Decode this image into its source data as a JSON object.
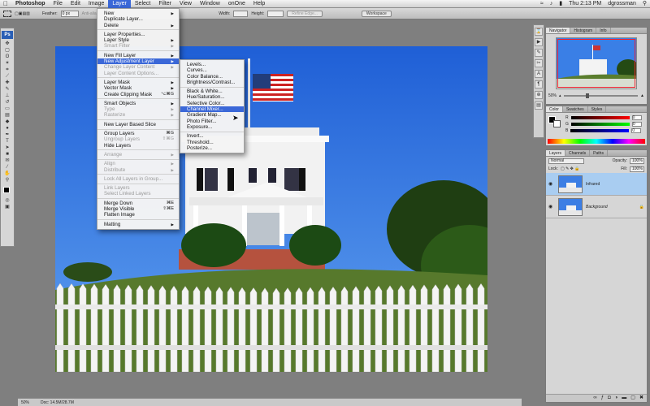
{
  "menubar": {
    "app": "Photoshop",
    "items": [
      "File",
      "Edit",
      "Image",
      "Layer",
      "Select",
      "Filter",
      "View",
      "Window",
      "onOne",
      "Help"
    ],
    "active": "Layer",
    "clock": "Thu 2:13 PM",
    "user": "dgrossman"
  },
  "options": {
    "feather_label": "Feather:",
    "feather_value": "0 px",
    "anti_alias": "Anti-alias",
    "width_label": "Width:",
    "height_label": "Height:",
    "refine_edge": "Refine Edge...",
    "workspace": "Workspace"
  },
  "layer_menu": [
    {
      "label": "New",
      "arrow": true
    },
    {
      "label": "Duplicate Layer..."
    },
    {
      "label": "Delete",
      "arrow": true
    },
    {
      "sep": true
    },
    {
      "label": "Layer Properties..."
    },
    {
      "label": "Layer Style",
      "arrow": true
    },
    {
      "label": "Smart Filter",
      "arrow": true,
      "disabled": true
    },
    {
      "sep": true
    },
    {
      "label": "New Fill Layer",
      "arrow": true
    },
    {
      "label": "New Adjustment Layer",
      "arrow": true,
      "highlight": true
    },
    {
      "label": "Change Layer Content",
      "arrow": true,
      "disabled": true
    },
    {
      "label": "Layer Content Options...",
      "disabled": true
    },
    {
      "sep": true
    },
    {
      "label": "Layer Mask",
      "arrow": true
    },
    {
      "label": "Vector Mask",
      "arrow": true
    },
    {
      "label": "Create Clipping Mask",
      "shortcut": "⌥⌘G"
    },
    {
      "sep": true
    },
    {
      "label": "Smart Objects",
      "arrow": true
    },
    {
      "label": "Type",
      "arrow": true,
      "disabled": true
    },
    {
      "label": "Rasterize",
      "arrow": true,
      "disabled": true
    },
    {
      "sep": true
    },
    {
      "label": "New Layer Based Slice"
    },
    {
      "sep": true
    },
    {
      "label": "Group Layers",
      "shortcut": "⌘G"
    },
    {
      "label": "Ungroup Layers",
      "shortcut": "⇧⌘G",
      "disabled": true
    },
    {
      "label": "Hide Layers"
    },
    {
      "sep": true
    },
    {
      "label": "Arrange",
      "arrow": true,
      "disabled": true
    },
    {
      "sep": true
    },
    {
      "label": "Align",
      "arrow": true,
      "disabled": true
    },
    {
      "label": "Distribute",
      "arrow": true,
      "disabled": true
    },
    {
      "sep": true
    },
    {
      "label": "Lock All Layers in Group...",
      "disabled": true
    },
    {
      "sep": true
    },
    {
      "label": "Link Layers",
      "disabled": true
    },
    {
      "label": "Select Linked Layers",
      "disabled": true
    },
    {
      "sep": true
    },
    {
      "label": "Merge Down",
      "shortcut": "⌘E"
    },
    {
      "label": "Merge Visible",
      "shortcut": "⇧⌘E"
    },
    {
      "label": "Flatten Image"
    },
    {
      "sep": true
    },
    {
      "label": "Matting",
      "arrow": true
    }
  ],
  "adjustment_menu": [
    {
      "label": "Levels..."
    },
    {
      "label": "Curves..."
    },
    {
      "label": "Color Balance..."
    },
    {
      "label": "Brightness/Contrast..."
    },
    {
      "sep": true
    },
    {
      "label": "Black & White..."
    },
    {
      "label": "Hue/Saturation..."
    },
    {
      "label": "Selective Color..."
    },
    {
      "label": "Channel Mixer...",
      "highlight": true
    },
    {
      "label": "Gradient Map..."
    },
    {
      "label": "Photo Filter..."
    },
    {
      "label": "Exposure..."
    },
    {
      "sep": true
    },
    {
      "label": "Invert..."
    },
    {
      "label": "Threshold..."
    },
    {
      "label": "Posterize..."
    }
  ],
  "navigator": {
    "tabs": [
      "Navigator",
      "Histogram",
      "Info"
    ],
    "zoom": "50%"
  },
  "color_panel": {
    "tabs": [
      "Color",
      "Swatches",
      "Styles"
    ],
    "channels": [
      {
        "label": "R",
        "value": "0"
      },
      {
        "label": "G",
        "value": "0"
      },
      {
        "label": "B",
        "value": "0"
      }
    ]
  },
  "layers_panel": {
    "tabs": [
      "Layers",
      "Channels",
      "Paths"
    ],
    "blend_mode": "Normal",
    "opacity_label": "Opacity:",
    "opacity": "100%",
    "lock_label": "Lock:",
    "fill_label": "Fill:",
    "fill": "100%",
    "layers": [
      {
        "name": "Infrared",
        "selected": true
      },
      {
        "name": "Background",
        "selected": false
      }
    ]
  },
  "status": {
    "zoom": "50%",
    "doc": "Doc: 14.5M/28.7M"
  },
  "toolbox": {
    "logo": "Ps"
  },
  "colors": {
    "accent": "#3b68d8",
    "sky": "#2f73e0",
    "selected_layer": "#a9cdf1"
  }
}
